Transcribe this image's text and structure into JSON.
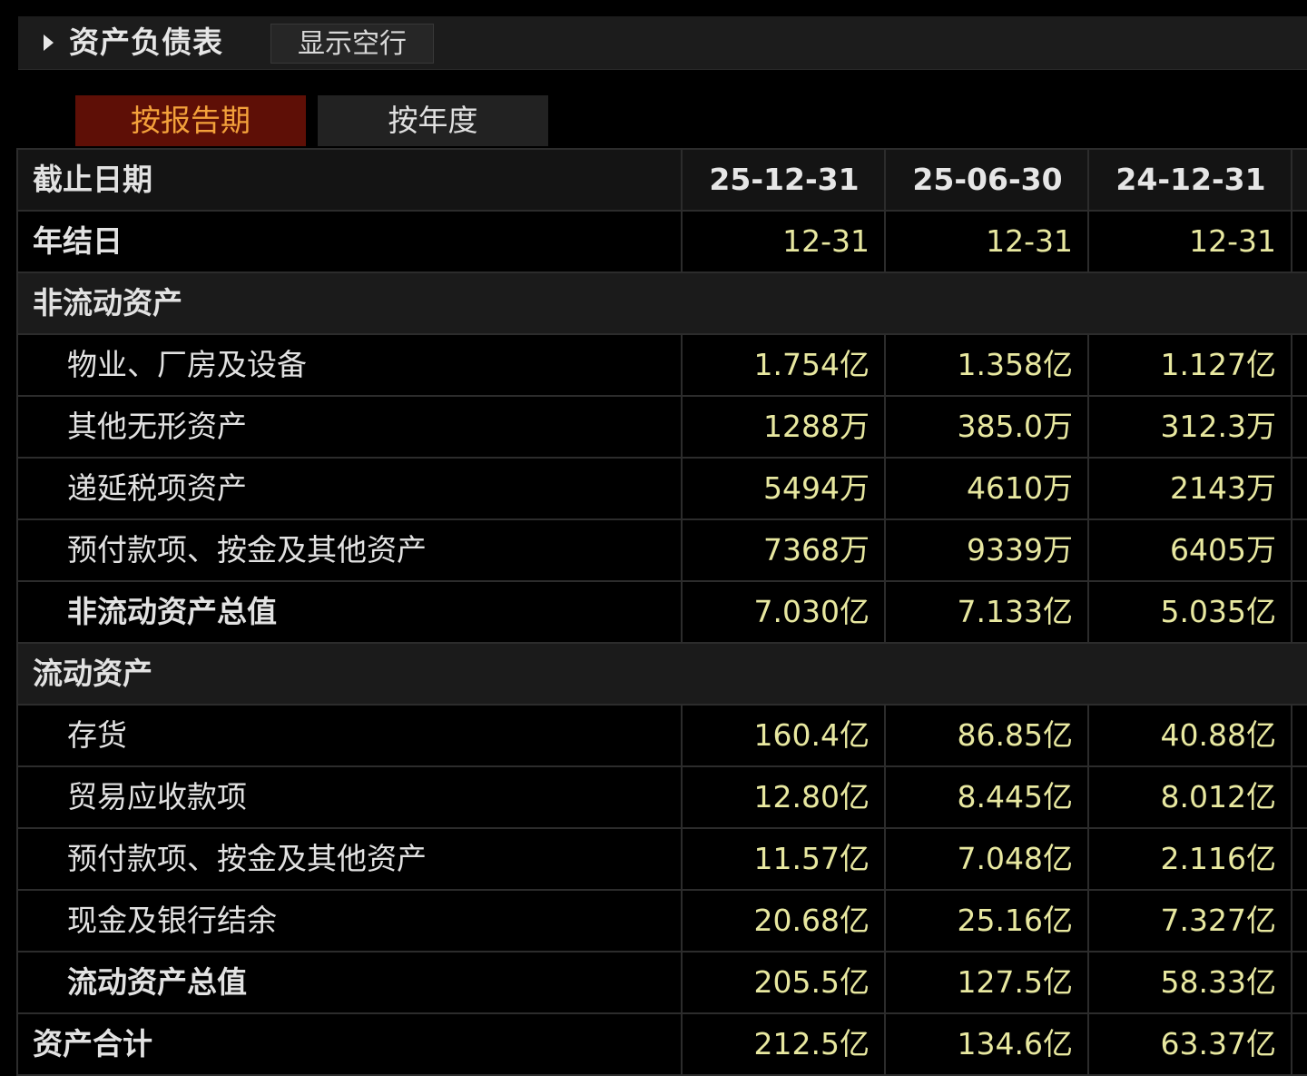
{
  "header": {
    "title": "资产负债表",
    "show_empty_label": "显示空行"
  },
  "tabs": [
    {
      "label": "按报告期",
      "active": true
    },
    {
      "label": "按年度",
      "active": false
    }
  ],
  "colors": {
    "background": "#000000",
    "value_text": "#e8e8a0",
    "active_tab_bg": "#5e0f06",
    "active_tab_text": "#f3a13b",
    "section_bg": "#1b1b1b"
  },
  "table": {
    "header": {
      "label": "截止日期",
      "cols": [
        "25-12-31",
        "25-06-30",
        "24-12-31"
      ]
    },
    "rows": [
      {
        "type": "data",
        "label": "年结日",
        "bold": true,
        "values": [
          "12-31",
          "12-31",
          "12-31"
        ]
      },
      {
        "type": "section",
        "label": "非流动资产"
      },
      {
        "type": "sub",
        "label": "物业、厂房及设备",
        "values": [
          "1.754亿",
          "1.358亿",
          "1.127亿"
        ]
      },
      {
        "type": "sub",
        "label": "其他无形资产",
        "values": [
          "1288万",
          "385.0万",
          "312.3万"
        ]
      },
      {
        "type": "sub",
        "label": "递延税项资产",
        "values": [
          "5494万",
          "4610万",
          "2143万"
        ]
      },
      {
        "type": "sub",
        "label": "预付款项、按金及其他资产",
        "values": [
          "7368万",
          "9339万",
          "6405万"
        ]
      },
      {
        "type": "subtotal",
        "label": "非流动资产总值",
        "values": [
          "7.030亿",
          "7.133亿",
          "5.035亿"
        ]
      },
      {
        "type": "section",
        "label": "流动资产"
      },
      {
        "type": "sub",
        "label": "存货",
        "values": [
          "160.4亿",
          "86.85亿",
          "40.88亿"
        ]
      },
      {
        "type": "sub",
        "label": "贸易应收款项",
        "values": [
          "12.80亿",
          "8.445亿",
          "8.012亿"
        ]
      },
      {
        "type": "sub",
        "label": "预付款项、按金及其他资产",
        "values": [
          "11.57亿",
          "7.048亿",
          "2.116亿"
        ]
      },
      {
        "type": "sub",
        "label": "现金及银行结余",
        "values": [
          "20.68亿",
          "25.16亿",
          "7.327亿"
        ]
      },
      {
        "type": "subtotal",
        "label": "流动资产总值",
        "values": [
          "205.5亿",
          "127.5亿",
          "58.33亿"
        ]
      },
      {
        "type": "data",
        "label": "资产合计",
        "bold": true,
        "values": [
          "212.5亿",
          "134.6亿",
          "63.37亿"
        ]
      }
    ]
  }
}
